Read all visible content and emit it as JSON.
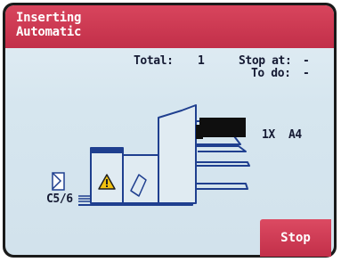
{
  "header": {
    "line1": "Inserting",
    "line2": "Automatic"
  },
  "counters": {
    "total_label": "Total:",
    "total_value": "1",
    "stop_at_label": "Stop at:",
    "stop_at_value": "-",
    "to_do_label": "To do:",
    "to_do_value": "-"
  },
  "feeder": {
    "sheet_count": "1X",
    "paper_size": "A4"
  },
  "envelope": {
    "size": "C5/6"
  },
  "actions": {
    "stop_label": "Stop"
  },
  "colors": {
    "header": "#c22f49",
    "machine_line": "#1f3f8f",
    "background": "#d6e6ef"
  },
  "icons": {
    "warning": "warning-icon",
    "envelope": "envelope-icon",
    "fold": "fold-icon"
  }
}
